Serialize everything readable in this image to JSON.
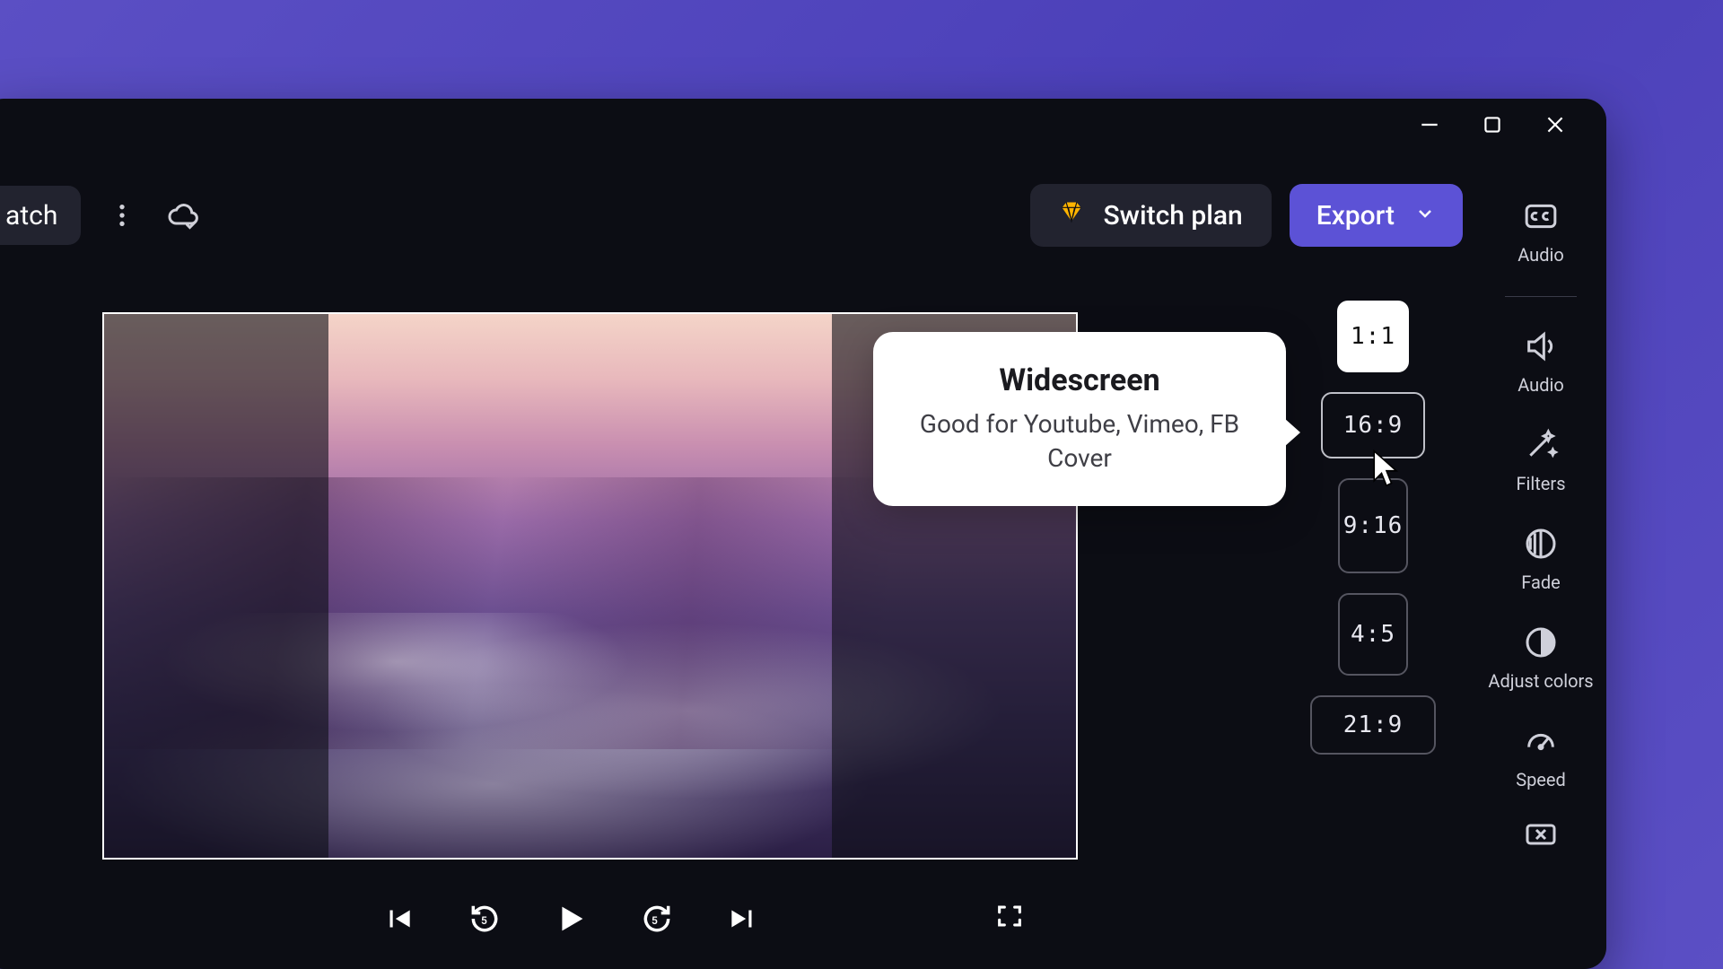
{
  "project_partial_name": "atch",
  "header": {
    "switch_plan": "Switch plan",
    "export": "Export"
  },
  "tooltip": {
    "title": "Widescreen",
    "body": "Good for Youtube, Vimeo, FB Cover"
  },
  "ratios": {
    "r11": "1:1",
    "r169": "16:9",
    "r916": "9:16",
    "r45": "4:5",
    "r219": "21:9"
  },
  "rail": {
    "cc": "Audio",
    "audio": "Audio",
    "filters": "Filters",
    "fade": "Fade",
    "adjust": "Adjust colors",
    "speed": "Speed"
  }
}
